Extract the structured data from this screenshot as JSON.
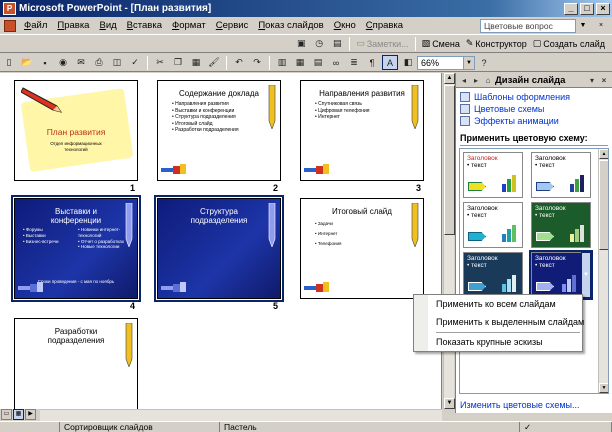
{
  "window": {
    "title": "Microsoft PowerPoint - [План развития]",
    "min": "_",
    "max": "□",
    "close": "×"
  },
  "menu": {
    "items": [
      "Файл",
      "Правка",
      "Вид",
      "Вставка",
      "Формат",
      "Сервис",
      "Показ слайдов",
      "Окно",
      "Справка"
    ],
    "help_placeholder": "Цветовые вопрос",
    "close": "×"
  },
  "toolbar_top": {
    "notes": "Заметки...",
    "slide_design": "Смена",
    "designer": "Конструктор",
    "new_slide": "Создать слайд"
  },
  "toolbar_std": {
    "zoom": "66%",
    "help": "?"
  },
  "slides": [
    {
      "num": "1",
      "title": "План развития",
      "subtitle": "Отдел информационных технологий"
    },
    {
      "num": "2",
      "title": "Содержание доклада",
      "bullets": [
        "Направления развития",
        "Выставки и конференции",
        "Структура подразделения",
        "Итоговый слайд",
        "Разработки подразделения"
      ]
    },
    {
      "num": "3",
      "title": "Направления развития",
      "bullets": [
        "Спутниковая связь",
        "Цифровая телефония",
        "Интернет"
      ]
    },
    {
      "num": "4",
      "title": "Выставки и конференции",
      "col1": [
        "Форумы",
        "Выставки",
        "Бизнес-встречи"
      ],
      "col2": [
        "Новинки интернет-технологий",
        "Отчет о разработках",
        "Новые технологии"
      ],
      "caption": "Сроки проведения - с мая по ноябрь"
    },
    {
      "num": "5",
      "title": "Структура подразделения"
    },
    {
      "num": "6",
      "title": "Итоговый слайд",
      "bullets": [
        "Задачи",
        "Интернет",
        "Телефония"
      ]
    },
    {
      "num": "7",
      "title": "Разработки подразделения"
    }
  ],
  "taskpane": {
    "title": "Дизайн слайда",
    "links": [
      "Шаблоны оформления",
      "Цветовые схемы",
      "Эффекты анимации"
    ],
    "section": "Применить цветовую схему:",
    "scheme_title": "Заголовок",
    "scheme_text": "текст",
    "footer_link": "Изменить цветовые схемы..."
  },
  "context_menu": {
    "items": [
      "Применить ко всем слайдам",
      "Применить к выделенным слайдам",
      "Показать крупные эскизы"
    ]
  },
  "statusbar": {
    "view": "Сортировщик слайдов",
    "design": "Пастель"
  },
  "colors": {
    "title_gradient_start": "#0a246a",
    "title_gradient_end": "#a6caf0",
    "selection": "#0a246a",
    "link": "#0033cc"
  }
}
